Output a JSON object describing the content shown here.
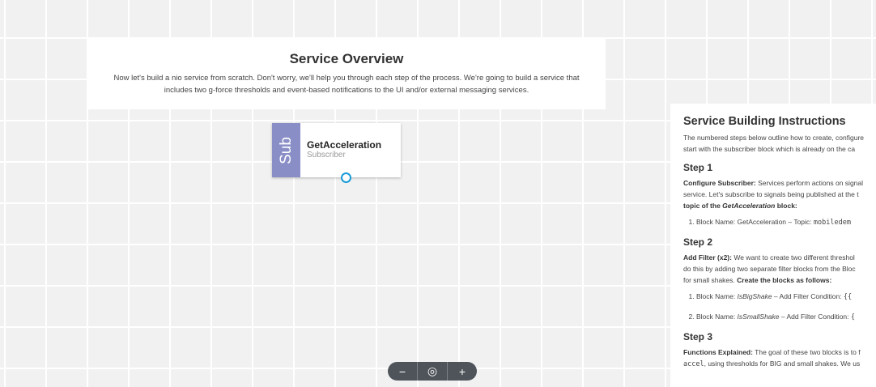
{
  "overview": {
    "title": "Service Overview",
    "line1": "Now let's build a nio service from scratch. Don't worry, we'll help you through each step of the process. We're going to build a service that",
    "line2": "includes two g-force thresholds and event-based notifications to the UI and/or external messaging services."
  },
  "block": {
    "tab_label": "Sub",
    "name": "GetAcceleration",
    "type": "Subscriber"
  },
  "zoom": {
    "minus": "−",
    "center": "◎",
    "plus": "+"
  },
  "instructions": {
    "title": "Service Building Instructions",
    "intro_line1": "The numbered steps below outline how to create, configure",
    "intro_line2": "start with the subscriber block which is already on the ca",
    "step1": {
      "heading": "Step 1",
      "label": "Configure Subscriber:",
      "text1": " Services perform actions on signal",
      "line2": "service. Let's subscribe to signals being published at the t",
      "line3_prefix": "topic of the ",
      "line3_italic": "GetAcceleration",
      "line3_suffix": " block:",
      "item1_text": "Block Name: GetAcceleration – Topic: ",
      "item1_code": "mobiledem"
    },
    "step2": {
      "heading": "Step 2",
      "label": "Add Filter (x2):",
      "text1": " We want to create two different threshol",
      "line2": "do this by adding two separate filter blocks from the Bloc",
      "line3": "for small shakes. ",
      "line3_bold": "Create the blocks as follows:",
      "item1_prefix": "Block Name: ",
      "item1_italic": "IsBigShake",
      "item1_suffix": " – Add Filter Condition: ",
      "item1_code": "{{",
      "item2_prefix": "Block Name: ",
      "item2_italic": "IsSmallShake",
      "item2_suffix": " – Add Filter Condition: ",
      "item2_code": "{"
    },
    "step3": {
      "heading": "Step 3",
      "label": "Functions Explained:",
      "text1": " The goal of these two blocks is to f",
      "line2_code": "accel",
      "line2": ", using thresholds for BIG and small shakes. We us"
    }
  }
}
